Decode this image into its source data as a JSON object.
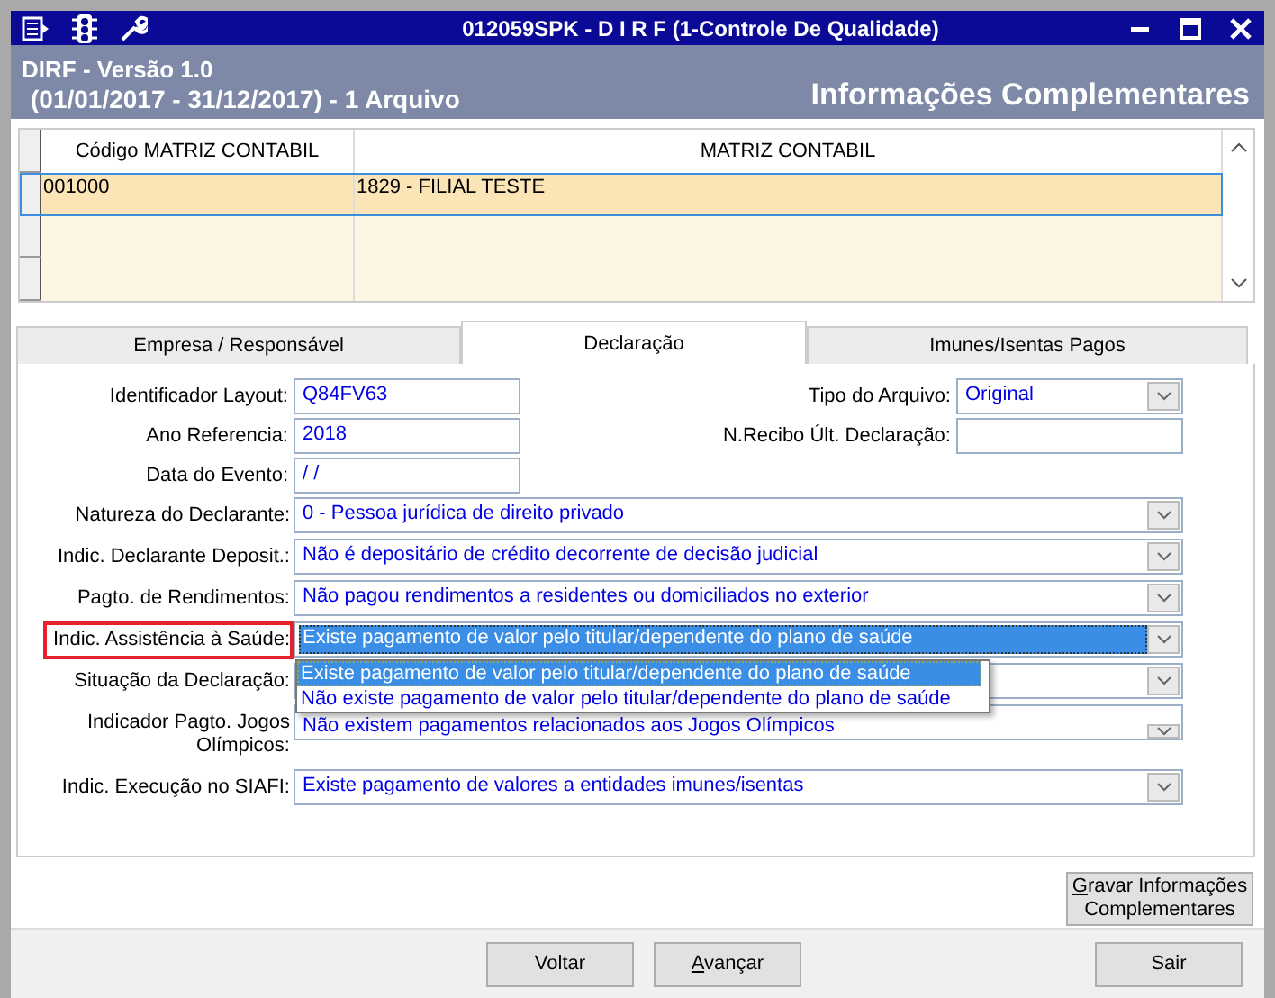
{
  "window": {
    "title": "012059SPK - D I R F (1-Controle De Qualidade)"
  },
  "header": {
    "line1": "DIRF - Versão 1.0",
    "line2": "(01/01/2017 - 31/12/2017) - 1 Arquivo",
    "section": "Informações Complementares"
  },
  "table": {
    "columns": [
      "Código MATRIZ CONTABIL",
      "MATRIZ CONTABIL"
    ],
    "rows": [
      {
        "cells": [
          "001000",
          "1829 - FILIAL TESTE"
        ],
        "selected": true
      }
    ]
  },
  "tabs": [
    {
      "label": "Empresa / Responsável",
      "selected": false
    },
    {
      "label": "Declaração",
      "selected": true
    },
    {
      "label": "Imunes/Isentas Pagos",
      "selected": false
    }
  ],
  "form": {
    "left": [
      {
        "label": "Identificador Layout:",
        "value": "Q84FV63",
        "kind": "text"
      },
      {
        "label": "Ano Referencia:",
        "value": "2018",
        "kind": "text"
      },
      {
        "label": "Data do Evento:",
        "value": "/ /",
        "kind": "text"
      }
    ],
    "right": [
      {
        "label": "Tipo do Arquivo:",
        "value": "Original",
        "kind": "combo"
      },
      {
        "label": "N.Recibo Últ. Declaração:",
        "kind": "text"
      }
    ],
    "rows": [
      {
        "label": "Natureza do Declarante:",
        "value": "0 - Pessoa jurídica de direito privado",
        "focused": false,
        "highlighted": false
      },
      {
        "label": "Indic. Declarante Deposit.:",
        "value": "Não é depositário de crédito decorrente de decisão judicial",
        "focused": false,
        "highlighted": false
      },
      {
        "label": "Pagto. de Rendimentos:",
        "value": "Não pagou rendimentos a residentes ou domiciliados no exterior",
        "focused": false,
        "highlighted": false
      },
      {
        "label": "Indic. Assistência à Saúde:",
        "value": "Existe pagamento de valor pelo titular/dependente do plano de saúde",
        "focused": true,
        "highlighted": true,
        "options": [
          {
            "text": "Existe pagamento de valor pelo titular/dependente do plano de saúde",
            "selected": true
          },
          {
            "text": "Não existe pagamento de valor pelo titular/dependente do plano de saúde",
            "selected": false
          }
        ]
      },
      {
        "label": "Situação da Declaração:",
        "focused": false,
        "highlighted": false
      },
      {
        "label": "Indicador Pagto. Jogos Olímpicos:",
        "value": "Não existem pagamentos relacionados aos Jogos Olímpicos",
        "focused": false,
        "highlighted": false
      },
      {
        "label": "Indic. Execução no SIAFI:",
        "value": "Existe pagamento de valores a entidades imunes/isentas",
        "focused": false,
        "highlighted": false
      }
    ]
  },
  "save_button": "Gravar Informações Complementares",
  "footer_buttons": [
    "Voltar",
    "Avançar",
    "Sair"
  ]
}
